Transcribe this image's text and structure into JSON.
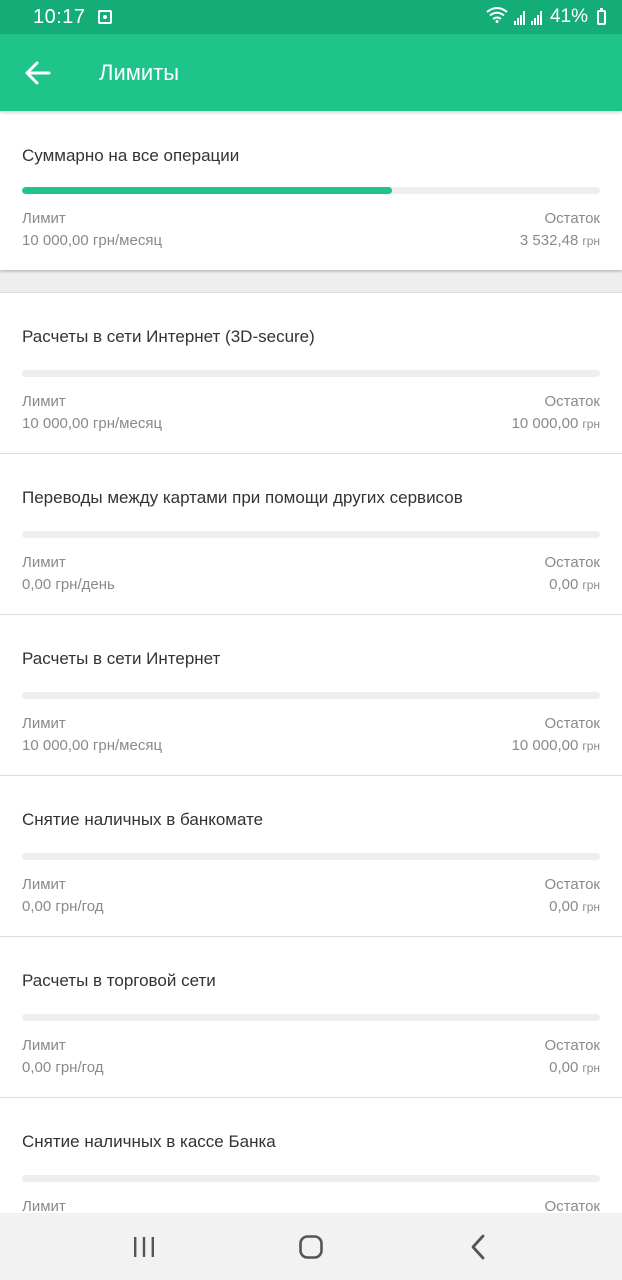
{
  "status_bar": {
    "time": "10:17",
    "battery_text": "41%"
  },
  "app_bar": {
    "title": "Лимиты",
    "back_icon": "arrow-left-icon"
  },
  "colors": {
    "status_bar": "#14ad78",
    "app_bar": "#1ec48a",
    "progress": "#1ec48a"
  },
  "summary": {
    "title": "Суммарно на все операции",
    "progress": 0.64,
    "limit_label": "Лимит",
    "limit_value": "10 000,00 грн/месяц",
    "rest_label": "Остаток",
    "rest_value": "3 532,48",
    "rest_currency": "грн"
  },
  "limits": [
    {
      "title": "Расчеты в сети Интернет (3D-secure)",
      "progress": 0,
      "limit_label": "Лимит",
      "limit_value": "10 000,00 грн/месяц",
      "rest_label": "Остаток",
      "rest_value": "10 000,00",
      "rest_currency": "грн"
    },
    {
      "title": "Переводы между картами при помощи других сервисов",
      "progress": 0,
      "limit_label": "Лимит",
      "limit_value": "0,00 грн/день",
      "rest_label": "Остаток",
      "rest_value": "0,00",
      "rest_currency": "грн"
    },
    {
      "title": "Расчеты в сети Интернет",
      "progress": 0,
      "limit_label": "Лимит",
      "limit_value": "10 000,00 грн/месяц",
      "rest_label": "Остаток",
      "rest_value": "10 000,00",
      "rest_currency": "грн"
    },
    {
      "title": "Снятие наличных в банкомате",
      "progress": 0,
      "limit_label": "Лимит",
      "limit_value": "0,00 грн/год",
      "rest_label": "Остаток",
      "rest_value": "0,00",
      "rest_currency": "грн"
    },
    {
      "title": "Расчеты в торговой сети",
      "progress": 0,
      "limit_label": "Лимит",
      "limit_value": "0,00 грн/год",
      "rest_label": "Остаток",
      "rest_value": "0,00",
      "rest_currency": "грн"
    },
    {
      "title": "Снятие наличных в кассе Банка",
      "progress": 0,
      "limit_label": "Лимит",
      "limit_value": "",
      "rest_label": "Остаток",
      "rest_value": "",
      "rest_currency": ""
    }
  ],
  "nav": {
    "recents_icon": "recent-apps-icon",
    "home_icon": "home-icon",
    "back_icon": "back-chevron-icon"
  }
}
